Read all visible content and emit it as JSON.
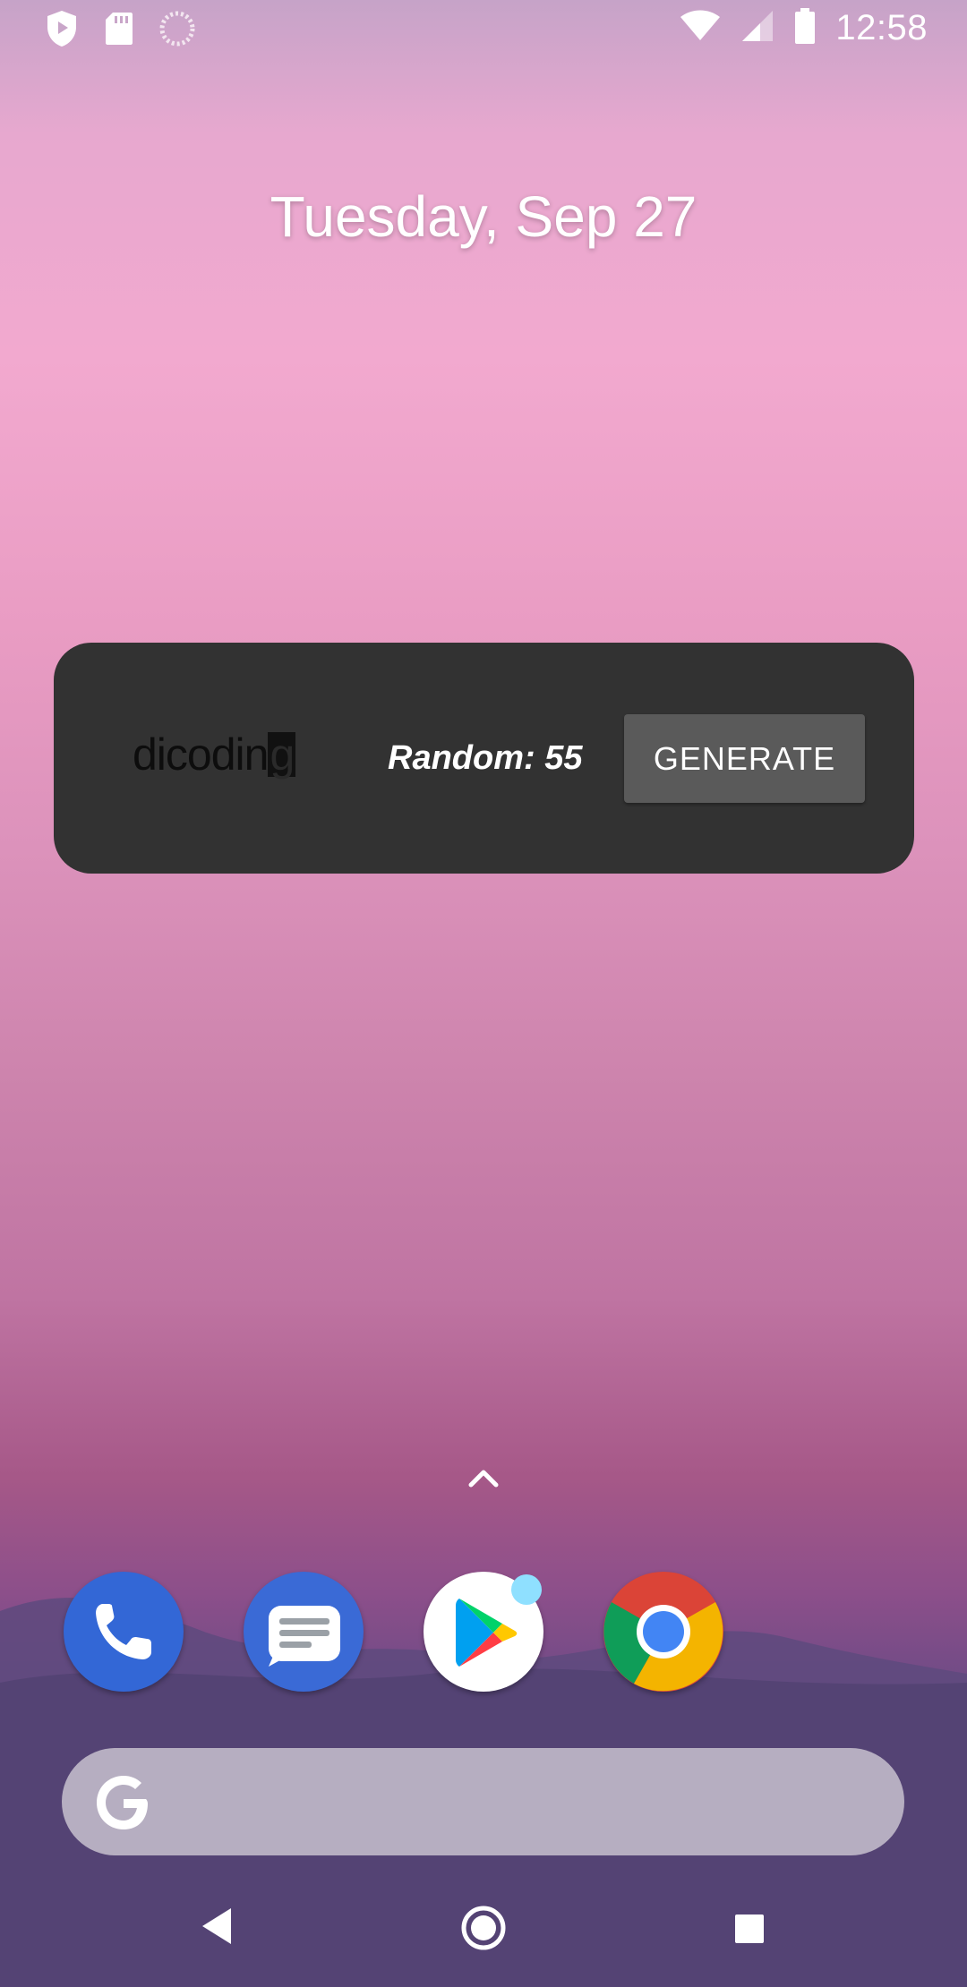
{
  "status_bar": {
    "time": "12:58",
    "left_icons": [
      "shield-icon",
      "sd-card-icon",
      "loading-icon"
    ],
    "right_icons": [
      "wifi-icon",
      "cellular-signal-icon",
      "battery-icon"
    ]
  },
  "home": {
    "date": "Tuesday, Sep 27"
  },
  "widget": {
    "logo_text": "dicodin",
    "logo_last_char": "g",
    "random_text": "Random: 55",
    "generate_label": "GENERATE",
    "background_color": "#323232",
    "button_color": "#5a5a5a"
  },
  "dock": {
    "apps": [
      "phone-app-icon",
      "messages-app-icon",
      "play-store-app-icon",
      "chrome-app-icon"
    ]
  },
  "search_bar": {
    "icon": "google-g-icon"
  },
  "nav_bar": {
    "buttons": [
      "back-button",
      "home-button",
      "recents-button"
    ]
  }
}
